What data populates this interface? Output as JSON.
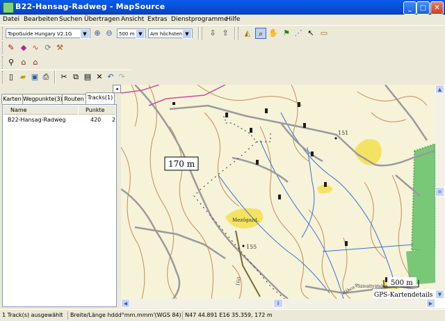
{
  "window": {
    "title": "B22-Hansag-Radweg - MapSource",
    "minimize": "_",
    "maximize": "□",
    "close": "✕"
  },
  "menu": [
    "Datei",
    "Bearbeiten",
    "Suchen",
    "Übertragen",
    "Ansicht",
    "Extras",
    "Dienstprogramme",
    "Hilfe"
  ],
  "toolbar": {
    "map_product": "TopoGuide Hungary V2.1G",
    "zoom_level": "500 m",
    "detail_level": "Am höchsten"
  },
  "left_pane": {
    "tabs": [
      "Karten",
      "Wegpunkte(3)",
      "Routen",
      "Tracks(1)"
    ],
    "active_tab": "Tracks(1)",
    "columns": [
      "Name",
      "Punkte"
    ],
    "rows": [
      {
        "name": "B22-Hansag-Radweg",
        "points": "420",
        "extra": "2"
      }
    ]
  },
  "map": {
    "distance_label": "170 m",
    "elevation_labels": [
      "151",
      "155",
      "160"
    ],
    "place_labels": [
      "Mezőgazd.",
      "Szivattyútelep",
      "Rábca-P"
    ],
    "scale_label": "500 m",
    "details_label": "GPS-Kartendetails"
  },
  "status": {
    "selection": "1 Track(s) ausgewählt",
    "format": "Breite/Länge hddd°mm.mmm'(WGS 84)",
    "coordinates": "N47 44.891 E16 35.359, 172 m"
  },
  "colors": {
    "titlebar": "#0a5ce9",
    "map_background": "#f6f3d9",
    "contour": "#c58a55",
    "road": "#9a9a9a",
    "water": "#3a6fd0",
    "forest": "#78c878",
    "settlement": "#f4e363"
  }
}
